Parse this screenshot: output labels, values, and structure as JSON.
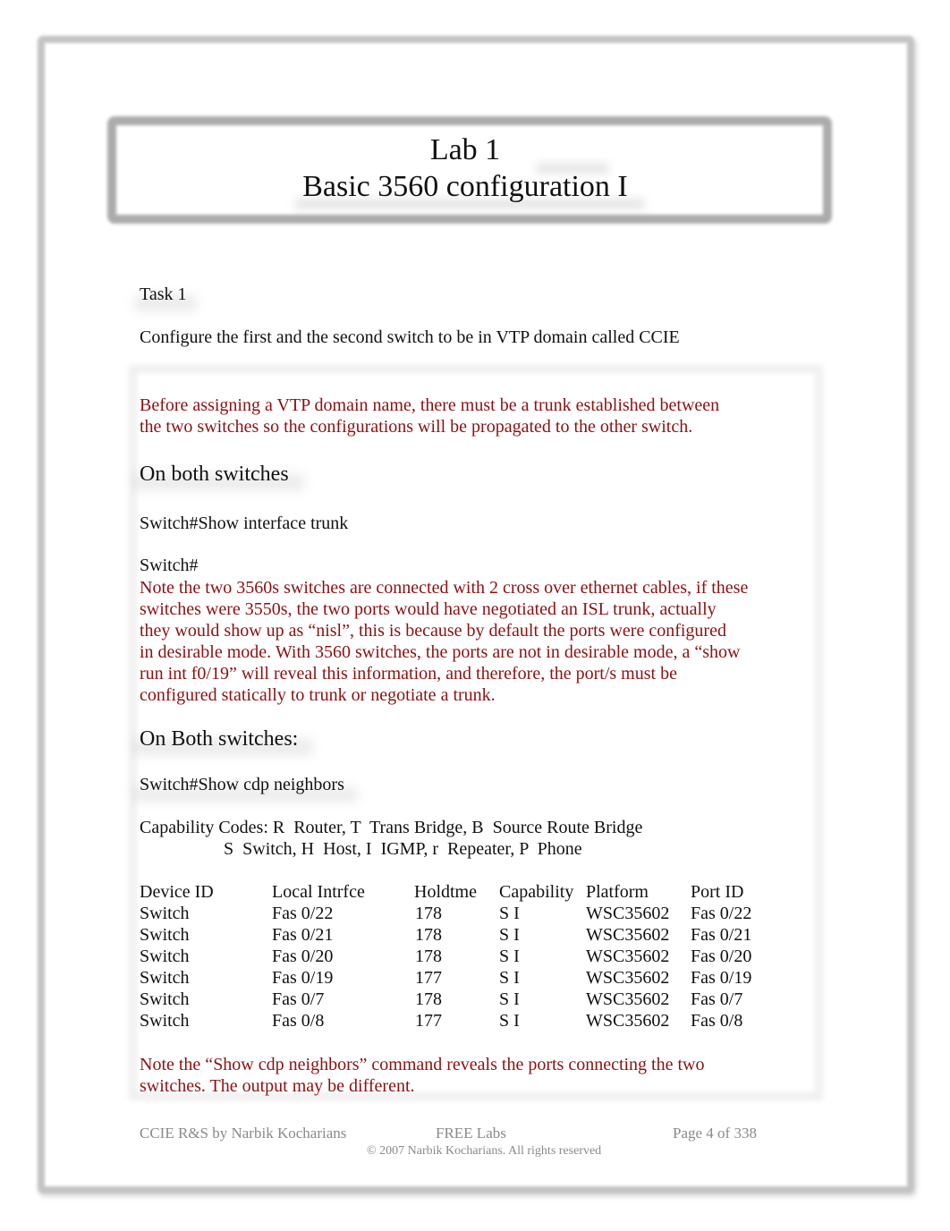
{
  "title": {
    "line1": "Lab 1",
    "line2": "Basic 3560 configuration I"
  },
  "task": {
    "label": "Task 1",
    "description": "Configure the first and the second switch to be in VTP domain called CCIE"
  },
  "solution": {
    "intro_lines": [
      "Before assigning a VTP domain name, there must be a trunk established between",
      "the two switches so the configurations will be propagated to the other switch."
    ],
    "heading1": "On both switches",
    "command1": "Switch#Show interface trunk",
    "prompt1": "Switch#",
    "note1_lines": [
      "Note the two 3560s switches are connected with 2 cross over ethernet cables, if these",
      "switches were 3550s, the two ports would have negotiated an ISL trunk, actually",
      "they would show up as “nisl”, this is because by default the ports were configured",
      "in desirable mode. With 3560 switches, the ports are not in desirable mode, a “show",
      "run int f0/19” will reveal this information, and therefore, the port/s must be",
      "configured statically to trunk or negotiate a trunk."
    ],
    "heading2": "On Both switches:",
    "command2": "Switch#Show cdp neighbors",
    "capability_codes_line1": "Capability Codes: R  Router, T  Trans Bridge, B  Source Route Bridge",
    "capability_codes_line2": "S  Switch, H  Host, I  IGMP, r  Repeater, P  Phone",
    "cdp_table": {
      "headers": [
        "Device ID",
        "Local Intrfce",
        "Holdtme",
        "Capability",
        "Platform",
        "Port ID"
      ],
      "rows": [
        [
          "Switch",
          "Fas 0/22",
          "178",
          "S I",
          "WSC35602",
          "Fas 0/22"
        ],
        [
          "Switch",
          "Fas 0/21",
          "178",
          "S I",
          "WSC35602",
          "Fas 0/21"
        ],
        [
          "Switch",
          "Fas 0/20",
          "178",
          "S I",
          "WSC35602",
          "Fas 0/20"
        ],
        [
          "Switch",
          "Fas 0/19",
          "177",
          "S I",
          "WSC35602",
          "Fas 0/19"
        ],
        [
          "Switch",
          "Fas 0/7",
          "178",
          "S I",
          "WSC35602",
          "Fas 0/7"
        ],
        [
          "Switch",
          "Fas 0/8",
          "177",
          "S I",
          "WSC35602",
          "Fas 0/8"
        ]
      ]
    },
    "note2_lines": [
      "Note the “Show cdp neighbors” command reveals the ports connecting the two",
      "switches. The output may be different."
    ]
  },
  "footer": {
    "left": "CCIE R&S by Narbik Kocharians",
    "center": "FREE Labs",
    "right": "Page 4 of 338",
    "copyright": "© 2007 Narbik Kocharians. All rights reserved"
  },
  "colors": {
    "note_text": "#8b1111",
    "body_text": "#111111",
    "footer_text": "#8a8a8a",
    "frame": "#c4c4c4"
  }
}
